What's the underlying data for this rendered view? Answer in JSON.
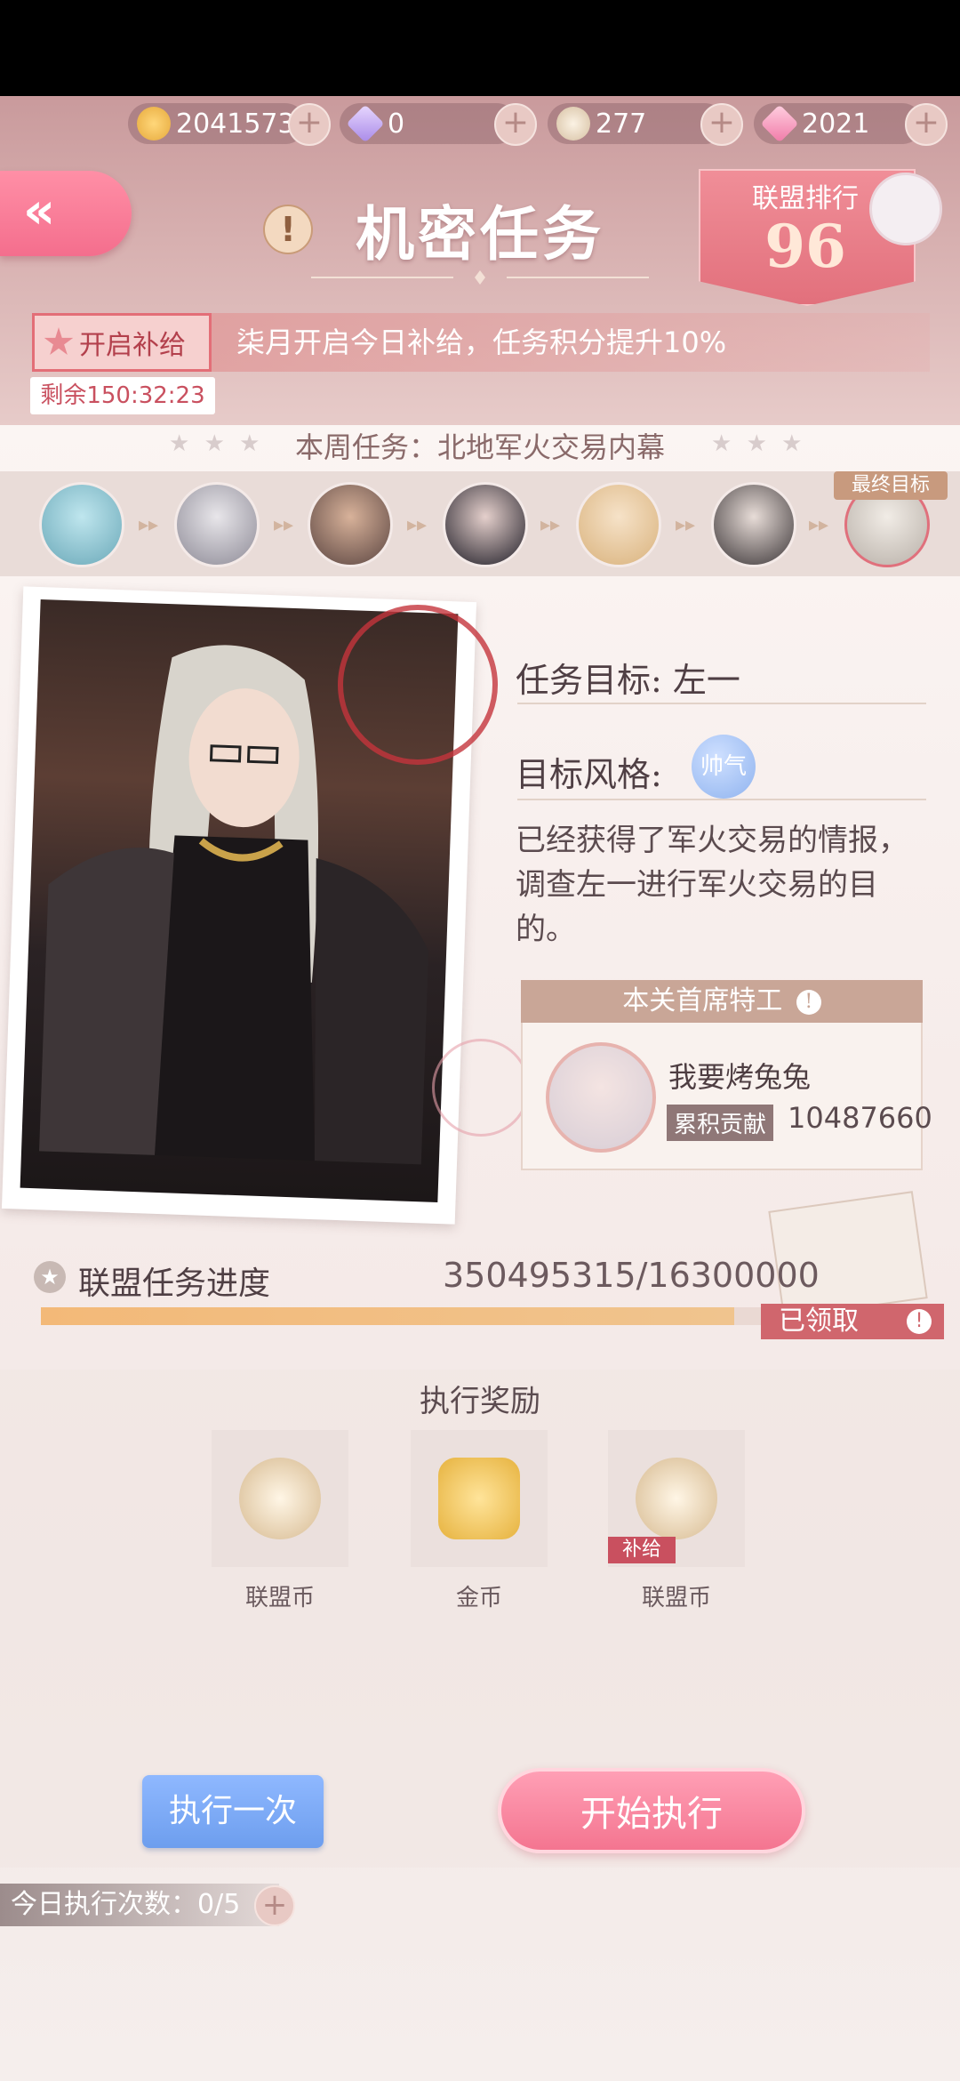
{
  "currencies": [
    {
      "icon": "cat-coin-icon",
      "value": "2041573"
    },
    {
      "icon": "diamond-icon",
      "value": "0"
    },
    {
      "icon": "alliance-coin-icon",
      "value": "277"
    },
    {
      "icon": "pink-diamond-icon",
      "value": "2021"
    }
  ],
  "header": {
    "title": "机密任务",
    "rank_label": "联盟排行",
    "rank_value": "96"
  },
  "supply": {
    "button_label": "开启补给",
    "message": "柒月开启今日补给，任务积分提升10%",
    "remaining": "剩余150:32:23"
  },
  "week_task": "本周任务：北地军火交易内幕",
  "final_target_tag": "最终目标",
  "task": {
    "target_label": "任务目标:",
    "target_name": "左一",
    "style_label": "目标风格:",
    "style_value": "帅气",
    "description": "已经获得了军火交易的情报，调查左一进行军火交易的目的。"
  },
  "chief_agent": {
    "header": "本关首席特工",
    "name": "我要烤兔兔",
    "contribution_label": "累积贡献",
    "contribution_value": "10487660"
  },
  "alliance_progress": {
    "label": "联盟任务进度",
    "value_text": "350495315/16300000",
    "claimed_label": "已领取"
  },
  "rewards": {
    "title": "执行奖励",
    "items": [
      {
        "label": "联盟币",
        "icon": "alliance-coin-icon"
      },
      {
        "label": "金币",
        "icon": "gold-cat-coin-icon"
      },
      {
        "label": "联盟币",
        "icon": "alliance-coin-icon",
        "tag": "补给"
      }
    ]
  },
  "buttons": {
    "exec_once": "执行一次",
    "start_exec": "开始执行"
  },
  "today": {
    "label": "今日执行次数：",
    "value": "0/5"
  },
  "colors": {
    "accent_pink": "#f47590",
    "accent_blue": "#6d9eee",
    "progress_orange": "#f3b978",
    "rank_red": "#e2707c"
  }
}
